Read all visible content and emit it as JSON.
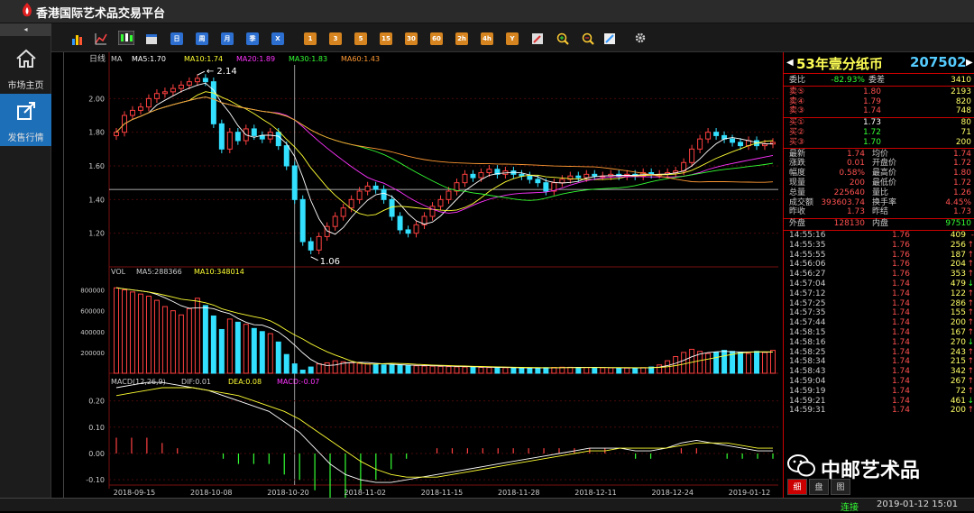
{
  "app": {
    "title": "香港国际艺术品交易平台"
  },
  "sidebar": {
    "collapse": "◂",
    "items": [
      {
        "label": "市场主页",
        "icon": "home-icon"
      },
      {
        "label": "发售行情",
        "icon": "share-icon"
      }
    ]
  },
  "toolbar": {
    "periods": [
      "日",
      "周",
      "月",
      "季",
      "X"
    ],
    "minutes": [
      "1",
      "3",
      "5",
      "15",
      "30",
      "60",
      "2h",
      "4h",
      "Y"
    ]
  },
  "chart": {
    "period_label": "日线",
    "ma_label": "MA",
    "ma": [
      {
        "name": "MA5:1.70",
        "color": "#ffffff"
      },
      {
        "name": "MA10:1.74",
        "color": "#ffff33"
      },
      {
        "name": "MA20:1.89",
        "color": "#ff33ff"
      },
      {
        "name": "MA30:1.83",
        "color": "#33ff33"
      },
      {
        "name": "MA60:1.43",
        "color": "#ff9933"
      }
    ],
    "high_label": "2.14",
    "low_label": "1.06",
    "price_ticks": [
      "2.00",
      "1.80",
      "1.60",
      "1.40",
      "1.20"
    ],
    "vol_label": "VOL",
    "vol_ma5": "MA5:288366",
    "vol_ma10": "MA10:348014",
    "vol_ticks": [
      "800000",
      "600000",
      "400000",
      "200000"
    ],
    "macd_label": "MACD(12,26,9)",
    "dif": "DIF:0.01",
    "dea": "DEA:0.08",
    "macd": "MACD:-0.07",
    "macd_ticks": [
      "0.20",
      "0.10",
      "0.00",
      "-0.10"
    ],
    "dates": [
      "2018-09-15",
      "2018-10-08",
      "2018-10-20",
      "2018-11-02",
      "2018-11-15",
      "2018-11-28",
      "2018-12-11",
      "2018-12-24",
      "2019-01-12"
    ]
  },
  "chart_data": {
    "type": "candlestick",
    "price_ylim": [
      1.0,
      2.2
    ],
    "close": [
      1.8,
      1.9,
      1.93,
      1.95,
      2.0,
      2.03,
      2.04,
      2.06,
      2.08,
      2.1,
      2.12,
      2.1,
      1.85,
      1.7,
      1.8,
      1.75,
      1.82,
      1.78,
      1.76,
      1.8,
      1.72,
      1.6,
      1.4,
      1.15,
      1.1,
      1.18,
      1.24,
      1.3,
      1.35,
      1.4,
      1.45,
      1.48,
      1.46,
      1.4,
      1.3,
      1.22,
      1.2,
      1.25,
      1.3,
      1.36,
      1.4,
      1.45,
      1.5,
      1.55,
      1.53,
      1.56,
      1.58,
      1.55,
      1.57,
      1.55,
      1.54,
      1.52,
      1.5,
      1.45,
      1.5,
      1.52,
      1.54,
      1.53,
      1.55,
      1.54,
      1.54,
      1.55,
      1.54,
      1.55,
      1.54,
      1.56,
      1.55,
      1.55,
      1.56,
      1.57,
      1.62,
      1.7,
      1.76,
      1.8,
      1.78,
      1.76,
      1.74,
      1.72,
      1.75,
      1.72,
      1.73,
      1.74
    ],
    "volume": [
      820000,
      800000,
      780000,
      760000,
      740000,
      700000,
      640000,
      600000,
      560000,
      620000,
      720000,
      650000,
      550000,
      420000,
      520000,
      490000,
      470000,
      430000,
      400000,
      380000,
      300000,
      180000,
      90000,
      30000,
      60000,
      90000,
      100000,
      120000,
      110000,
      100000,
      95000,
      90000,
      85000,
      80000,
      78000,
      76000,
      74000,
      72000,
      70000,
      68000,
      66000,
      64000,
      62000,
      60000,
      58000,
      56000,
      55000,
      54000,
      53000,
      52000,
      51000,
      50000,
      52000,
      54000,
      56000,
      58000,
      57000,
      56000,
      55000,
      54000,
      53000,
      52000,
      51000,
      50000,
      52000,
      54000,
      60000,
      80000,
      120000,
      160000,
      200000,
      230000,
      210000,
      190000,
      200000,
      220000,
      210000,
      200000,
      190000,
      210000,
      200000,
      220000
    ],
    "dif": [
      0.25,
      0.26,
      0.27,
      0.27,
      0.26,
      0.25,
      0.24,
      0.22,
      0.2,
      0.18,
      0.16,
      0.12,
      0.08,
      0.02,
      -0.04,
      -0.08,
      -0.1,
      -0.11,
      -0.11,
      -0.1,
      -0.09,
      -0.08,
      -0.07,
      -0.06,
      -0.05,
      -0.04,
      -0.03,
      -0.02,
      -0.01,
      0.0,
      0.01,
      0.02,
      0.02,
      0.02,
      0.01,
      0.01,
      0.02,
      0.04,
      0.05,
      0.04,
      0.03,
      0.02,
      0.01,
      0.01
    ],
    "dea": [
      0.22,
      0.23,
      0.24,
      0.25,
      0.25,
      0.25,
      0.24,
      0.23,
      0.22,
      0.2,
      0.18,
      0.16,
      0.13,
      0.09,
      0.05,
      0.01,
      -0.03,
      -0.06,
      -0.08,
      -0.09,
      -0.09,
      -0.09,
      -0.08,
      -0.07,
      -0.06,
      -0.05,
      -0.04,
      -0.03,
      -0.02,
      -0.01,
      0.0,
      0.01,
      0.01,
      0.02,
      0.02,
      0.02,
      0.02,
      0.03,
      0.04,
      0.04,
      0.04,
      0.03,
      0.02,
      0.02
    ],
    "macd_ylim": [
      -0.12,
      0.25
    ],
    "vol_ylim": [
      0,
      900000
    ]
  },
  "quote": {
    "name": "53年壹分纸币",
    "code": "207502",
    "weibi": {
      "label": "委比",
      "val": "-82.93%",
      "label2": "委差",
      "val2": "3410"
    },
    "asks": [
      {
        "label": "卖⑤",
        "price": "1.80",
        "vol": "2193"
      },
      {
        "label": "卖④",
        "price": "1.79",
        "vol": "820"
      },
      {
        "label": "卖③",
        "price": "1.74",
        "vol": "748"
      }
    ],
    "bids": [
      {
        "label": "买①",
        "price": "1.73",
        "vol": "80"
      },
      {
        "label": "买②",
        "price": "1.72",
        "vol": "71"
      },
      {
        "label": "买③",
        "price": "1.70",
        "vol": "200"
      }
    ],
    "stats": [
      {
        "l1": "最新",
        "v1": "1.74",
        "l2": "均价",
        "v2": "1.74"
      },
      {
        "l1": "涨跌",
        "v1": "0.01",
        "l2": "开盘价",
        "v2": "1.72"
      },
      {
        "l1": "幅度",
        "v1": "0.58%",
        "l2": "最高价",
        "v2": "1.80"
      },
      {
        "l1": "现量",
        "v1": "200",
        "l2": "最低价",
        "v2": "1.72"
      },
      {
        "l1": "总量",
        "v1": "225640",
        "l2": "量比",
        "v2": "1.26"
      },
      {
        "l1": "成交额",
        "v1": "393603.74",
        "l2": "换手率",
        "v2": "4.45%"
      },
      {
        "l1": "昨收",
        "v1": "1.73",
        "l2": "昨结",
        "v2": "1.73"
      }
    ],
    "outer": {
      "l1": "外盘",
      "v1": "128130",
      "l2": "内盘",
      "v2": "97510"
    },
    "trades": [
      {
        "t": "14:55:16",
        "p": "1.76",
        "v": "409",
        "d": "-"
      },
      {
        "t": "14:55:35",
        "p": "1.76",
        "v": "256",
        "d": "↑"
      },
      {
        "t": "14:55:55",
        "p": "1.76",
        "v": "187",
        "d": "↑"
      },
      {
        "t": "14:56:06",
        "p": "1.76",
        "v": "204",
        "d": "↑"
      },
      {
        "t": "14:56:27",
        "p": "1.76",
        "v": "353",
        "d": "↑"
      },
      {
        "t": "14:57:04",
        "p": "1.74",
        "v": "479",
        "d": "↓"
      },
      {
        "t": "14:57:12",
        "p": "1.74",
        "v": "122",
        "d": "↑"
      },
      {
        "t": "14:57:25",
        "p": "1.74",
        "v": "286",
        "d": "↑"
      },
      {
        "t": "14:57:35",
        "p": "1.74",
        "v": "155",
        "d": "↑"
      },
      {
        "t": "14:57:44",
        "p": "1.74",
        "v": "200",
        "d": "↑"
      },
      {
        "t": "14:58:15",
        "p": "1.74",
        "v": "167",
        "d": "↑"
      },
      {
        "t": "14:58:16",
        "p": "1.74",
        "v": "270",
        "d": "↓"
      },
      {
        "t": "14:58:25",
        "p": "1.74",
        "v": "243",
        "d": "↑"
      },
      {
        "t": "14:58:34",
        "p": "1.74",
        "v": "215",
        "d": "↑"
      },
      {
        "t": "14:58:43",
        "p": "1.74",
        "v": "342",
        "d": "↑"
      },
      {
        "t": "14:59:04",
        "p": "1.74",
        "v": "267",
        "d": "↑"
      },
      {
        "t": "14:59:19",
        "p": "1.74",
        "v": "72",
        "d": "↑"
      },
      {
        "t": "14:59:21",
        "p": "1.74",
        "v": "461",
        "d": "↓"
      },
      {
        "t": "14:59:31",
        "p": "1.74",
        "v": "200",
        "d": "↑"
      }
    ]
  },
  "tabs": [
    "细",
    "盘",
    "图"
  ],
  "status": {
    "conn": "连接",
    "datetime": "2019-01-12 15:01"
  },
  "watermark": "中邮艺术品"
}
